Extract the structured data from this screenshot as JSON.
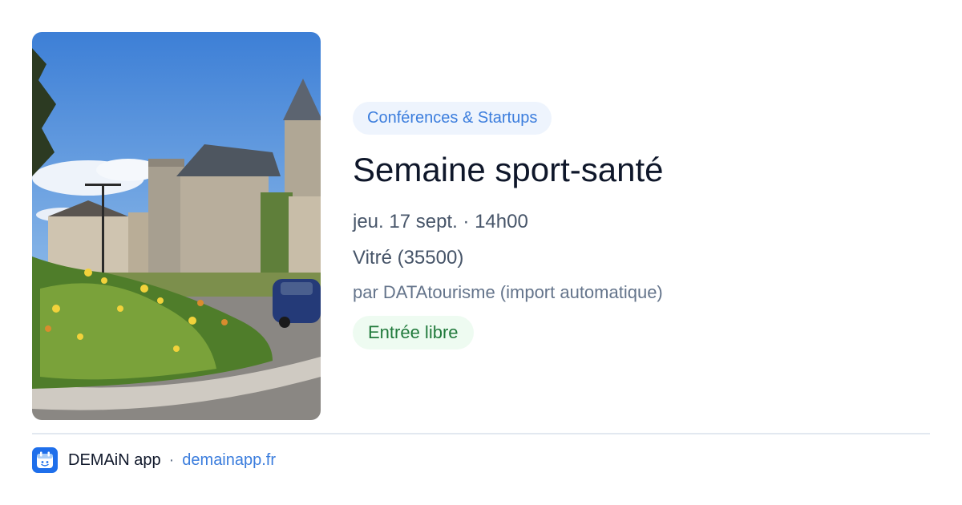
{
  "event": {
    "category": "Conférences & Startups",
    "title": "Semaine sport-santé",
    "datetime": "jeu. 17 sept. · 14h00",
    "location": "Vitré (35500)",
    "organizer": "par DATAtourisme (import automatique)",
    "price": "Entrée libre",
    "photo_icon": "event-photo-castle-flowerbed"
  },
  "footer": {
    "app_name": "DEMAiN app",
    "separator": "·",
    "url": "demainapp.fr",
    "logo_icon": "calendar-app-icon"
  },
  "colors": {
    "accent": "#3b7ddd",
    "category_bg": "#eef4fd",
    "price_text": "#217a3c",
    "price_bg": "#eefbf1",
    "logo_bg": "#1f6feb"
  }
}
